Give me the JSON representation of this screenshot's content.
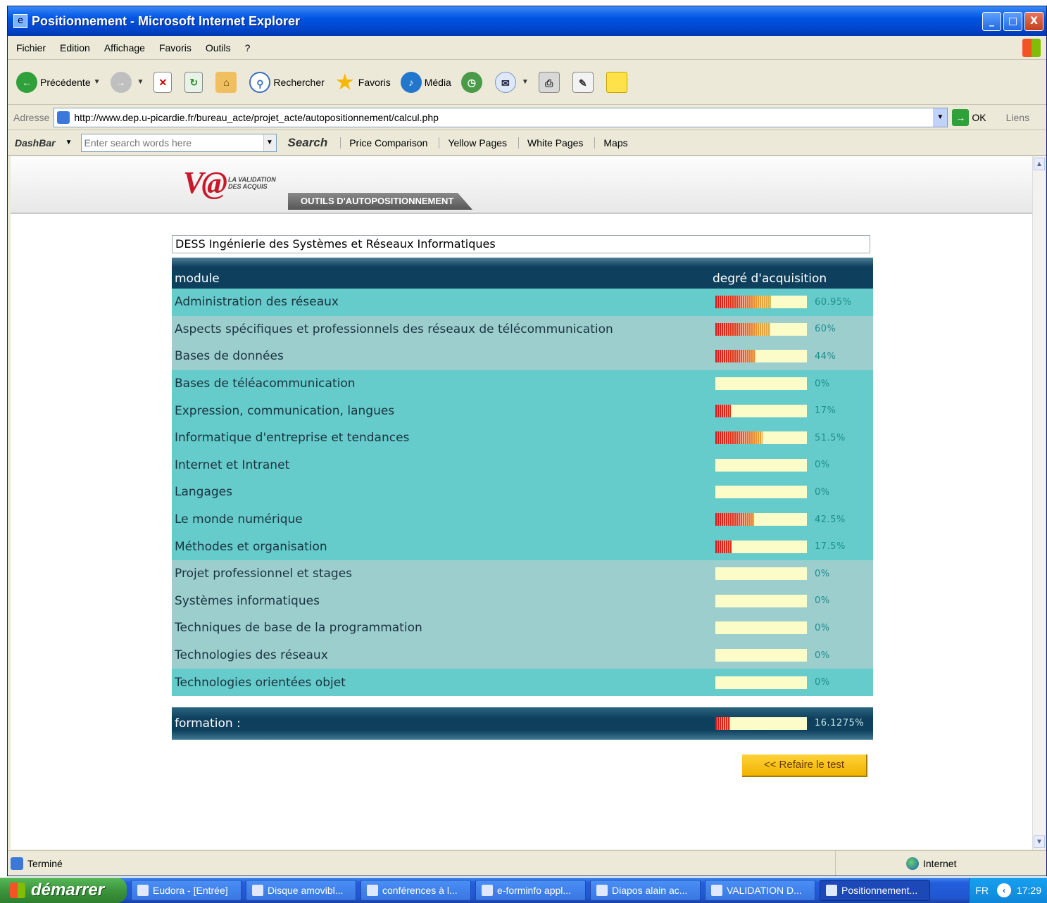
{
  "window": {
    "title": "Positionnement - Microsoft Internet Explorer",
    "buttons": [
      "_",
      "□",
      "X"
    ]
  },
  "menu": [
    "Fichier",
    "Edition",
    "Affichage",
    "Favoris",
    "Outils",
    "?"
  ],
  "toolbar": {
    "back": "Précédente",
    "search": "Rechercher",
    "favorites": "Favoris",
    "media": "Média"
  },
  "address": {
    "label": "Adresse",
    "url": "http://www.dep.u-picardie.fr/bureau_acte/projet_acte/autopositionnement/calcul.php",
    "go": "OK",
    "links": "Liens"
  },
  "dashbar": {
    "brand": "DashBar",
    "search_placeholder": "Enter search words here",
    "search_button": "Search",
    "links": [
      "Price Comparison",
      "Yellow Pages",
      "White Pages",
      "Maps"
    ]
  },
  "site": {
    "logo_mark": "V@",
    "logo_line1": "LA VALIDATION",
    "logo_line2": "DES ACQUIS",
    "tab": "OUTILS D'AUTOPOSITIONNEMENT",
    "course": "DESS Ingénierie des Systèmes et Réseaux Informatiques"
  },
  "table": {
    "col_module": "module",
    "col_degree": "degré d'acquisition",
    "rows": [
      {
        "module": "Administration des réseaux",
        "value": 60.95,
        "pct": "60.95%",
        "shade": "a"
      },
      {
        "module": "Aspects spécifiques et professionnels des réseaux de télécommunication",
        "value": 60,
        "pct": "60%",
        "shade": "b"
      },
      {
        "module": "Bases de données",
        "value": 44,
        "pct": "44%",
        "shade": "b"
      },
      {
        "module": "Bases de téléacommunication",
        "value": 0,
        "pct": "0%",
        "shade": "a"
      },
      {
        "module": "Expression, communication, langues",
        "value": 17,
        "pct": "17%",
        "shade": "a"
      },
      {
        "module": "Informatique d'entreprise et tendances",
        "value": 51.5,
        "pct": "51.5%",
        "shade": "a"
      },
      {
        "module": "Internet et Intranet",
        "value": 0,
        "pct": "0%",
        "shade": "a"
      },
      {
        "module": "Langages",
        "value": 0,
        "pct": "0%",
        "shade": "a"
      },
      {
        "module": "Le monde numérique",
        "value": 42.5,
        "pct": "42.5%",
        "shade": "a"
      },
      {
        "module": "Méthodes et organisation",
        "value": 17.5,
        "pct": "17.5%",
        "shade": "a"
      },
      {
        "module": "Projet professionnel et stages",
        "value": 0,
        "pct": "0%",
        "shade": "b"
      },
      {
        "module": "Systèmes informatiques",
        "value": 0,
        "pct": "0%",
        "shade": "b"
      },
      {
        "module": "Techniques de base de la programmation",
        "value": 0,
        "pct": "0%",
        "shade": "b"
      },
      {
        "module": "Technologies des réseaux",
        "value": 0,
        "pct": "0%",
        "shade": "b"
      },
      {
        "module": "Technologies orientées objet",
        "value": 0,
        "pct": "0%",
        "shade": "a"
      }
    ],
    "total_label": "formation :",
    "total_value": 16.1275,
    "total_pct": "16.1275%"
  },
  "retake_button": "<< Refaire le test",
  "status": {
    "text": "Terminé",
    "zone": "Internet"
  },
  "taskbar": {
    "start": "démarrer",
    "tasks": [
      {
        "label": "Eudora - [Entrée]",
        "active": false
      },
      {
        "label": "Disque amovibl...",
        "active": false
      },
      {
        "label": "conférences à l...",
        "active": false
      },
      {
        "label": "e-forminfo appl...",
        "active": false
      },
      {
        "label": "Diapos alain ac...",
        "active": false
      },
      {
        "label": "VALIDATION D...",
        "active": false
      },
      {
        "label": "Positionnement...",
        "active": true
      }
    ],
    "lang": "FR",
    "clock": "17:29"
  }
}
